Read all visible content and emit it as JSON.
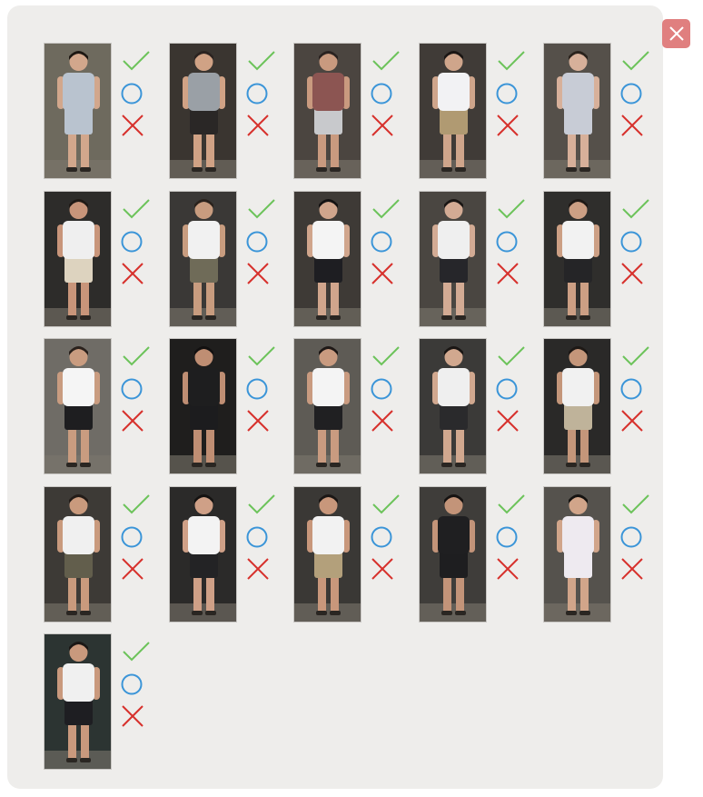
{
  "window": {
    "close_icon": "close-icon",
    "close_color": "#e07f7f"
  },
  "actions": {
    "accept_icon": "check-icon",
    "accept_color": "#6cc35a",
    "unsure_icon": "circle-icon",
    "unsure_color": "#3b95d8",
    "reject_icon": "cross-icon",
    "reject_color": "#d7312c"
  },
  "candidates": [
    {
      "bg": "#6e6a5e",
      "top": "#b9c3cf",
      "bottom": "#b9c3cf",
      "skin": "#d2a78c",
      "hair": "#1d1712"
    },
    {
      "bg": "#3a3530",
      "top": "#9aa0a6",
      "bottom": "#2a2726",
      "skin": "#d0a285",
      "hair": "#2b2320"
    },
    {
      "bg": "#4b4540",
      "top": "#8c5552",
      "bottom": "#c8c9cc",
      "skin": "#c99a7f",
      "hair": "#2a2220"
    },
    {
      "bg": "#403b37",
      "top": "#f2f2f4",
      "bottom": "#b09a72",
      "skin": "#cfa58b",
      "hair": "#1b1614"
    },
    {
      "bg": "#55504a",
      "top": "#c8ccd6",
      "bottom": "#c8ccd6",
      "skin": "#d7b09a",
      "hair": "#2a221c"
    },
    {
      "bg": "#2d2c2a",
      "top": "#efefef",
      "bottom": "#ddd3bf",
      "skin": "#c8957a",
      "hair": "#201a16"
    },
    {
      "bg": "#3a3836",
      "top": "#f1f1f1",
      "bottom": "#6f6b58",
      "skin": "#c89c7f",
      "hair": "#2a221c"
    },
    {
      "bg": "#3e3a36",
      "top": "#f4f4f4",
      "bottom": "#1e1e22",
      "skin": "#d0a58c",
      "hair": "#141212"
    },
    {
      "bg": "#4a4641",
      "top": "#efefef",
      "bottom": "#26262a",
      "skin": "#d3ab94",
      "hair": "#1a1614"
    },
    {
      "bg": "#2f2e2c",
      "top": "#f2f2f2",
      "bottom": "#252527",
      "skin": "#cc9f84",
      "hair": "#1f1916"
    },
    {
      "bg": "#6f6c66",
      "top": "#f5f5f5",
      "bottom": "#1e1e20",
      "skin": "#c99c80",
      "hair": "#2a211c"
    },
    {
      "bg": "#1f1e1d",
      "top": "#1e1e1f",
      "bottom": "#1c1c1e",
      "skin": "#bf8e73",
      "hair": "#121010"
    },
    {
      "bg": "#5e5b55",
      "top": "#f4f4f4",
      "bottom": "#202022",
      "skin": "#c99b80",
      "hair": "#1e1816"
    },
    {
      "bg": "#3b3a38",
      "top": "#efefef",
      "bottom": "#2a2a2c",
      "skin": "#d1a88f",
      "hair": "#1a1614"
    },
    {
      "bg": "#2a2928",
      "top": "#f1f1f1",
      "bottom": "#bfb39a",
      "skin": "#c4967a",
      "hair": "#1d1815"
    },
    {
      "bg": "#3d3a36",
      "top": "#f0f0f0",
      "bottom": "#625e4c",
      "skin": "#c99a7d",
      "hair": "#231c18"
    },
    {
      "bg": "#2b2a29",
      "top": "#f3f3f3",
      "bottom": "#232325",
      "skin": "#cfa087",
      "hair": "#141211"
    },
    {
      "bg": "#3a3835",
      "top": "#f2f2f2",
      "bottom": "#b3a07b",
      "skin": "#c8977b",
      "hair": "#1b1715"
    },
    {
      "bg": "#3f3d3a",
      "top": "#1f1f21",
      "bottom": "#1e1e20",
      "skin": "#c39479",
      "hair": "#161312"
    },
    {
      "bg": "#55524d",
      "top": "#eeeaf0",
      "bottom": "#eeeaf0",
      "skin": "#d1a58a",
      "hair": "#151311"
    },
    {
      "bg": "#2c3432",
      "top": "#f0f0f0",
      "bottom": "#1e1e22",
      "skin": "#c9997d",
      "hair": "#1b1715"
    }
  ]
}
